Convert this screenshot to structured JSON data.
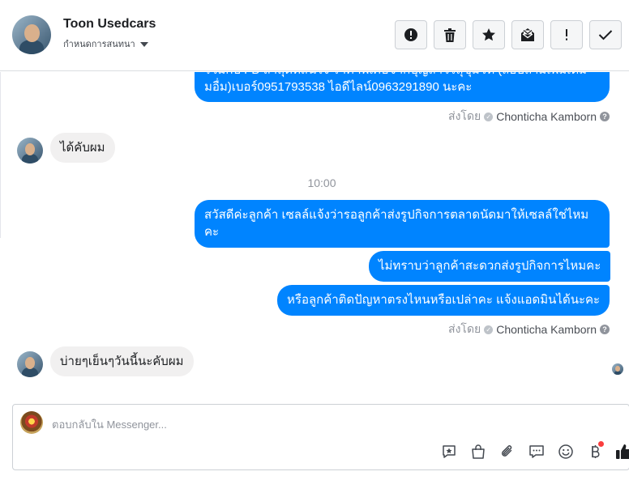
{
  "header": {
    "contact_name": "Toon Usedcars",
    "assign_label": "กำหนดการสนทนา",
    "buttons": [
      {
        "name": "mark-spam-button",
        "icon": "alert-circle-icon"
      },
      {
        "name": "delete-button",
        "icon": "trash-icon"
      },
      {
        "name": "star-button",
        "icon": "star-icon"
      },
      {
        "name": "mark-unread-button",
        "icon": "envelope-icon"
      },
      {
        "name": "follow-up-button",
        "icon": "exclamation-icon"
      },
      {
        "name": "mark-done-button",
        "icon": "check-icon"
      }
    ]
  },
  "messages": {
    "outgoing_top_line1": "ร่วมกับ FB ล่าสุดที่สนใจ ราคาพิเศษจากบุญถาวรสุขุมวิท (สอบถามเพิ่มเติม",
    "outgoing_top_line2": "มอื่ม)เบอร์0951793538 ไอดีไลน์0963291890 นะคะ",
    "sent_by_1": {
      "label": "ส่งโดย",
      "agent": "Chonticha Kamborn"
    },
    "incoming_1": "ได้คับผม",
    "timestamp": "10:00",
    "outgoing_2": "สวัสดีค่ะลูกค้า เซลล์แจ้งว่ารอลูกค้าส่งรูปกิจการตลาดนัดมาให้เซลล์ใช่ไหมคะ",
    "outgoing_3": "ไม่ทราบว่าลูกค้าสะดวกส่งรูปกิจการไหมคะ",
    "outgoing_4": "หรือลูกค้าติดปัญหาตรงไหนหรือเปล่าคะ แจ้งแอดมินได้นะคะ",
    "sent_by_2": {
      "label": "ส่งโดย",
      "agent": "Chonticha Kamborn"
    },
    "incoming_2": "บ่ายๆเย็นๆวันนี้นะคับผม"
  },
  "composer": {
    "placeholder": "ตอบกลับใน Messenger...",
    "tools": [
      "saved-reply-icon",
      "shop-bag-icon",
      "attachment-icon",
      "chat-bubbles-icon",
      "emoji-icon",
      "baht-payment-icon",
      "thumbs-up-icon"
    ]
  },
  "colors": {
    "accent": "#0084ff",
    "incoming_bubble": "#f1f0f0",
    "like": "#1c1e21"
  }
}
